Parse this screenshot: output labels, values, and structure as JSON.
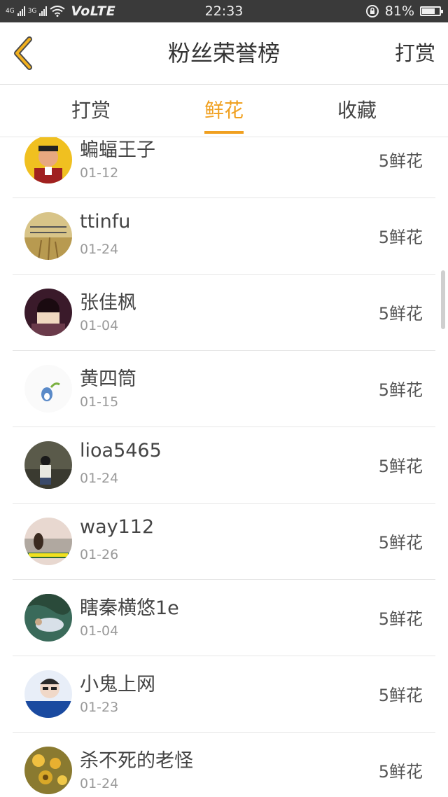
{
  "status_bar": {
    "net1": "4G",
    "net2": "3G",
    "volte": "VoLTE",
    "time": "22:33",
    "battery": "81%",
    "battery_level": 0.81
  },
  "header": {
    "title": "粉丝荣誉榜",
    "reward_button": "打赏"
  },
  "tabs": [
    {
      "label": "打赏",
      "active": false
    },
    {
      "label": "鲜花",
      "active": true
    },
    {
      "label": "收藏",
      "active": false
    }
  ],
  "rows": [
    {
      "name": "蝙蝠王子",
      "date": "01-12",
      "amount": "5鲜花"
    },
    {
      "name": "ttinfu",
      "date": "01-24",
      "amount": "5鲜花"
    },
    {
      "name": "张佳枫",
      "date": "01-04",
      "amount": "5鲜花"
    },
    {
      "name": "黄四筒",
      "date": "01-15",
      "amount": "5鲜花"
    },
    {
      "name": "lioa5465",
      "date": "01-24",
      "amount": "5鲜花"
    },
    {
      "name": "way112",
      "date": "01-26",
      "amount": "5鲜花"
    },
    {
      "name": "瞎秦横悠1e",
      "date": "01-04",
      "amount": "5鲜花"
    },
    {
      "name": "小鬼上网",
      "date": "01-23",
      "amount": "5鲜花"
    },
    {
      "name": "杀不死的老怪",
      "date": "01-24",
      "amount": "5鲜花"
    }
  ],
  "colors": {
    "accent": "#f0a020",
    "back_chevron": "#f2b01e",
    "status_bar_bg": "#3a3a3a"
  }
}
